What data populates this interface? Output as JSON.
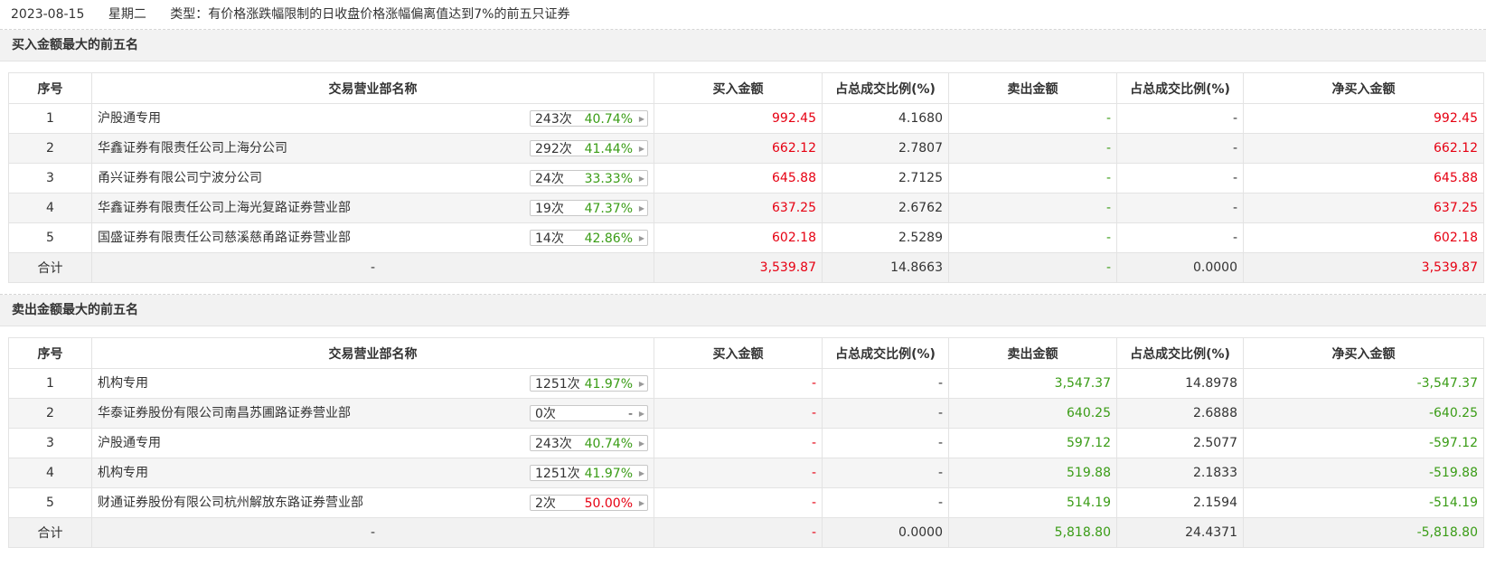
{
  "header": {
    "date": "2023-08-15",
    "weekday": "星期二",
    "type_text": "类型：有价格涨跌幅限制的日收盘价格涨幅偏离值达到7%的前五只证券"
  },
  "columns": [
    "序号",
    "交易营业部名称",
    "买入金额",
    "占总成交比例(%)",
    "卖出金额",
    "占总成交比例(%)",
    "净买入金额"
  ],
  "buy": {
    "title": "买入金额最大的前五名",
    "rows": [
      {
        "no": "1",
        "name": "沪股通专用",
        "count": "243次",
        "pct": "40.74%",
        "buy": "992.45",
        "buy_ratio": "4.1680",
        "sell": "-",
        "sell_ratio": "-",
        "net": "992.45"
      },
      {
        "no": "2",
        "name": "华鑫证券有限责任公司上海分公司",
        "count": "292次",
        "pct": "41.44%",
        "buy": "662.12",
        "buy_ratio": "2.7807",
        "sell": "-",
        "sell_ratio": "-",
        "net": "662.12"
      },
      {
        "no": "3",
        "name": "甬兴证券有限公司宁波分公司",
        "count": "24次",
        "pct": "33.33%",
        "buy": "645.88",
        "buy_ratio": "2.7125",
        "sell": "-",
        "sell_ratio": "-",
        "net": "645.88"
      },
      {
        "no": "4",
        "name": "华鑫证券有限责任公司上海光复路证券营业部",
        "count": "19次",
        "pct": "47.37%",
        "buy": "637.25",
        "buy_ratio": "2.6762",
        "sell": "-",
        "sell_ratio": "-",
        "net": "637.25"
      },
      {
        "no": "5",
        "name": "国盛证券有限责任公司慈溪慈甬路证券营业部",
        "count": "14次",
        "pct": "42.86%",
        "buy": "602.18",
        "buy_ratio": "2.5289",
        "sell": "-",
        "sell_ratio": "-",
        "net": "602.18"
      }
    ],
    "total": {
      "label": "合计",
      "name": "-",
      "buy": "3,539.87",
      "buy_ratio": "14.8663",
      "sell": "-",
      "sell_ratio": "0.0000",
      "net": "3,539.87"
    }
  },
  "sell": {
    "title": "卖出金额最大的前五名",
    "rows": [
      {
        "no": "1",
        "name": "机构专用",
        "count": "1251次",
        "pct": "41.97%",
        "buy": "-",
        "buy_ratio": "-",
        "sell": "3,547.37",
        "sell_ratio": "14.8978",
        "net": "-3,547.37"
      },
      {
        "no": "2",
        "name": "华泰证券股份有限公司南昌苏圃路证券营业部",
        "count": "0次",
        "pct": "-",
        "buy": "-",
        "buy_ratio": "-",
        "sell": "640.25",
        "sell_ratio": "2.6888",
        "net": "-640.25"
      },
      {
        "no": "3",
        "name": "沪股通专用",
        "count": "243次",
        "pct": "40.74%",
        "buy": "-",
        "buy_ratio": "-",
        "sell": "597.12",
        "sell_ratio": "2.5077",
        "net": "-597.12"
      },
      {
        "no": "4",
        "name": "机构专用",
        "count": "1251次",
        "pct": "41.97%",
        "buy": "-",
        "buy_ratio": "-",
        "sell": "519.88",
        "sell_ratio": "2.1833",
        "net": "-519.88"
      },
      {
        "no": "5",
        "name": "财通证券股份有限公司杭州解放东路证券营业部",
        "count": "2次",
        "pct": "50.00%",
        "buy": "-",
        "buy_ratio": "-",
        "sell": "514.19",
        "sell_ratio": "2.1594",
        "net": "-514.19"
      }
    ],
    "total": {
      "label": "合计",
      "name": "-",
      "buy": "-",
      "buy_ratio": "0.0000",
      "sell": "5,818.80",
      "sell_ratio": "24.4371",
      "net": "-5,818.80"
    }
  },
  "colors": {
    "up": "#e60012",
    "down": "#3a9c16",
    "stripe": "#f5f5f5"
  }
}
